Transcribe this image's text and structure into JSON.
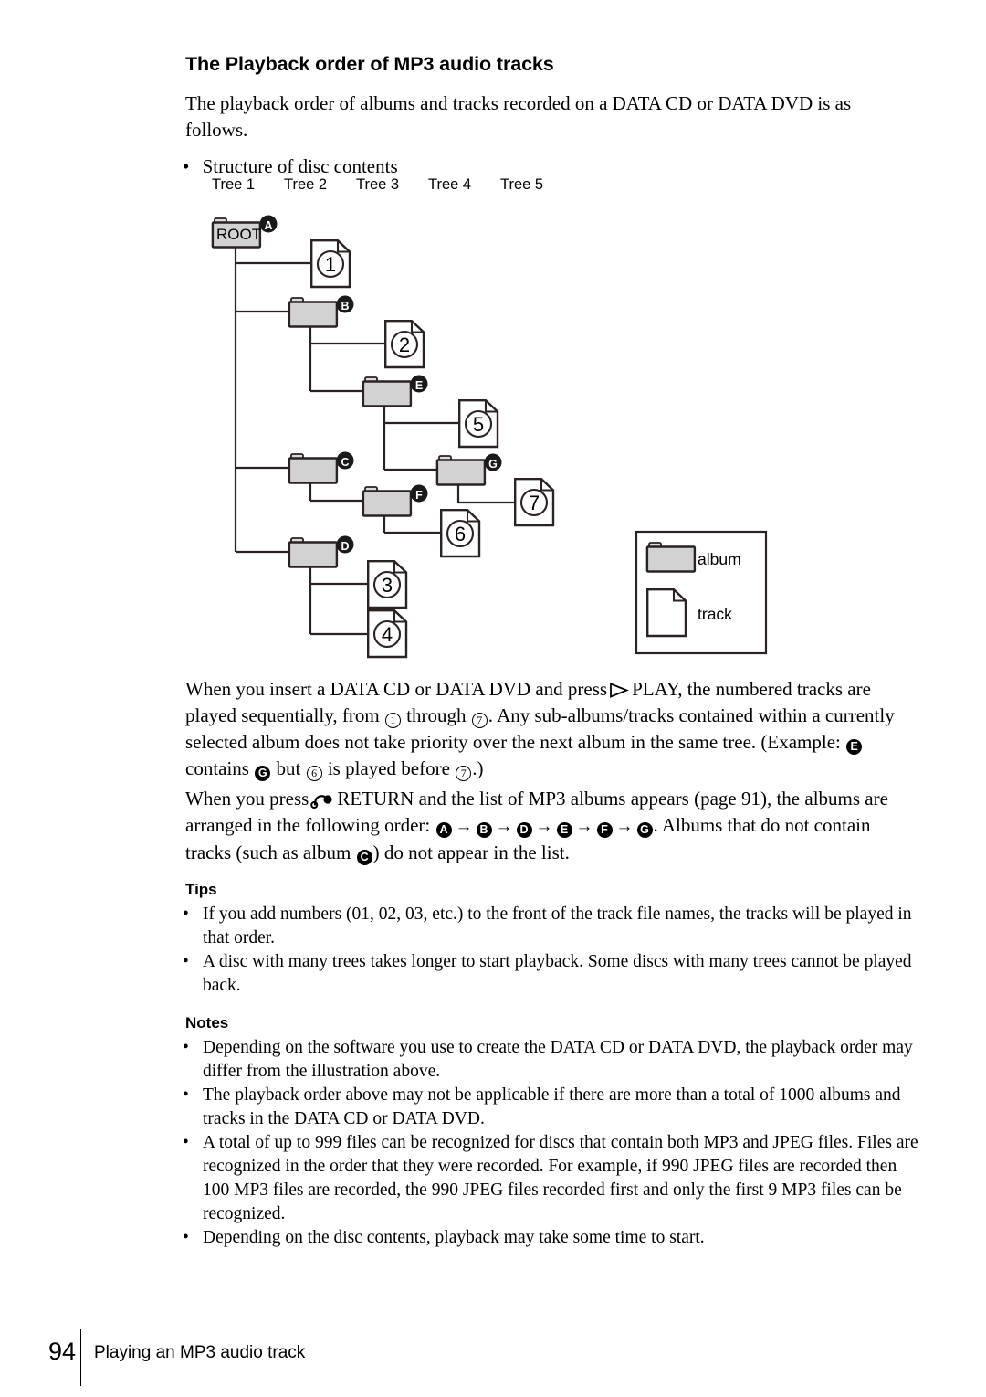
{
  "section": {
    "title": "The Playback order of MP3 audio tracks",
    "intro": "The playback order of albums and tracks recorded on a DATA CD or DATA DVD is as follows.",
    "structure_bullet": "Structure of disc contents"
  },
  "tree_labels": [
    "Tree 1",
    "Tree 2",
    "Tree 3",
    "Tree 4",
    "Tree 5"
  ],
  "diagram": {
    "root_label": "ROOT",
    "albums": [
      {
        "id": "A",
        "label": "ROOT",
        "tree": 1
      },
      {
        "id": "B",
        "label": "",
        "tree": 2
      },
      {
        "id": "C",
        "label": "",
        "tree": 2
      },
      {
        "id": "D",
        "label": "",
        "tree": 2
      },
      {
        "id": "E",
        "label": "",
        "tree": 3
      },
      {
        "id": "F",
        "label": "",
        "tree": 3
      },
      {
        "id": "G",
        "label": "",
        "tree": 4
      }
    ],
    "tracks": [
      {
        "number": "1",
        "parent": "A",
        "tree": 2
      },
      {
        "number": "2",
        "parent": "B",
        "tree": 3
      },
      {
        "number": "3",
        "parent": "D",
        "tree": 3
      },
      {
        "number": "4",
        "parent": "D",
        "tree": 3
      },
      {
        "number": "5",
        "parent": "E",
        "tree": 4
      },
      {
        "number": "6",
        "parent": "F",
        "tree": 4
      },
      {
        "number": "7",
        "parent": "G",
        "tree": 5
      }
    ],
    "legend": {
      "album_label": "album",
      "track_label": "track"
    }
  },
  "paragraphs": {
    "p1_a": "When you insert a DATA CD or DATA DVD and press",
    "p1_play": "PLAY, the numbered",
    "p1_b": "tracks are played sequentially, from",
    "p1_c": "through",
    "p1_d": ".  Any sub-albums/tracks contained",
    "p1_e": "within a currently selected album does not take priority over the next album in the",
    "p1_f": "same tree. (Example:",
    "p1_g": "contains",
    "p1_h": "but",
    "p1_i": "is played before",
    "p1_j": ".)",
    "p1_from": "1",
    "p1_through": "7",
    "p1_ex_e": "E",
    "p1_ex_g": "G",
    "p1_ex_6": "6",
    "p1_ex_7": "7",
    "p2_a": "When you press",
    "p2_b": "RETURN and the list of MP3 albums appears (page 91), the",
    "p2_c": "albums are arranged in the following order:",
    "p2_order": [
      "A",
      "B",
      "D",
      "E",
      "F",
      "G"
    ],
    "p2_period": ".",
    "p2_d": "Albums that do not contain tracks (such as album",
    "p2_c_badge": "C",
    "p2_e": ") do not appear in the list."
  },
  "tips": {
    "heading": "Tips",
    "items": [
      "If you add numbers (01, 02, 03, etc.) to the front of the track file names, the tracks will be played in that order.",
      "A disc with many trees takes longer to start playback.  Some discs with many trees cannot be played back."
    ]
  },
  "notes": {
    "heading": "Notes",
    "items": [
      "Depending on the software you use to create the DATA CD or DATA DVD, the playback order may differ from the illustration above.",
      "The playback order above may not be applicable if there are more than a total of 1000 albums and tracks in the DATA CD or DATA DVD.",
      "A total of up to 999 files can be recognized for discs that contain both MP3 and JPEG files. Files are recognized in the order that they were recorded.  For example, if 990 JPEG files are recorded then 100 MP3 files are recorded, the 990 JPEG files recorded first and only the first 9 MP3 files can be recognized.",
      "Depending on the disc contents, playback may take some time to start."
    ]
  },
  "footer": {
    "page_number": "94",
    "running_title": "Playing an MP3 audio track"
  },
  "colors": {
    "folder_fill": "#d2d2d2",
    "outline": "#2b2222",
    "text": "#000000"
  }
}
